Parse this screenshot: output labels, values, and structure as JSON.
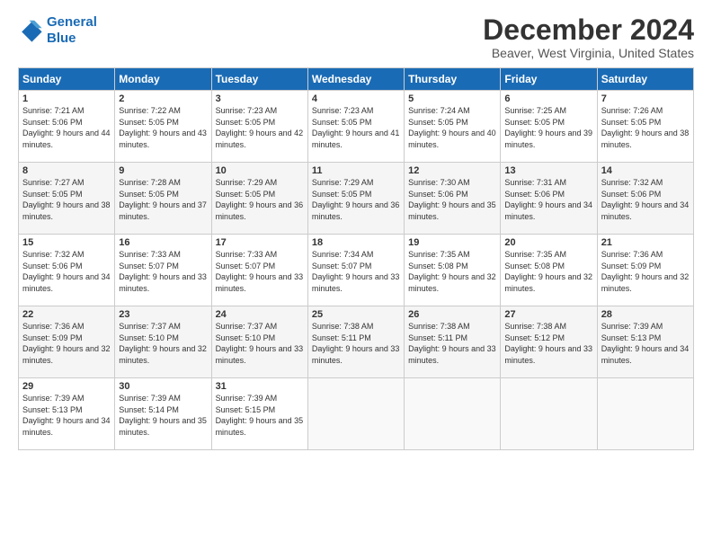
{
  "logo": {
    "line1": "General",
    "line2": "Blue"
  },
  "title": "December 2024",
  "subtitle": "Beaver, West Virginia, United States",
  "days_header": [
    "Sunday",
    "Monday",
    "Tuesday",
    "Wednesday",
    "Thursday",
    "Friday",
    "Saturday"
  ],
  "weeks": [
    [
      {
        "day": "1",
        "sunrise": "Sunrise: 7:21 AM",
        "sunset": "Sunset: 5:06 PM",
        "daylight": "Daylight: 9 hours and 44 minutes."
      },
      {
        "day": "2",
        "sunrise": "Sunrise: 7:22 AM",
        "sunset": "Sunset: 5:05 PM",
        "daylight": "Daylight: 9 hours and 43 minutes."
      },
      {
        "day": "3",
        "sunrise": "Sunrise: 7:23 AM",
        "sunset": "Sunset: 5:05 PM",
        "daylight": "Daylight: 9 hours and 42 minutes."
      },
      {
        "day": "4",
        "sunrise": "Sunrise: 7:23 AM",
        "sunset": "Sunset: 5:05 PM",
        "daylight": "Daylight: 9 hours and 41 minutes."
      },
      {
        "day": "5",
        "sunrise": "Sunrise: 7:24 AM",
        "sunset": "Sunset: 5:05 PM",
        "daylight": "Daylight: 9 hours and 40 minutes."
      },
      {
        "day": "6",
        "sunrise": "Sunrise: 7:25 AM",
        "sunset": "Sunset: 5:05 PM",
        "daylight": "Daylight: 9 hours and 39 minutes."
      },
      {
        "day": "7",
        "sunrise": "Sunrise: 7:26 AM",
        "sunset": "Sunset: 5:05 PM",
        "daylight": "Daylight: 9 hours and 38 minutes."
      }
    ],
    [
      {
        "day": "8",
        "sunrise": "Sunrise: 7:27 AM",
        "sunset": "Sunset: 5:05 PM",
        "daylight": "Daylight: 9 hours and 38 minutes."
      },
      {
        "day": "9",
        "sunrise": "Sunrise: 7:28 AM",
        "sunset": "Sunset: 5:05 PM",
        "daylight": "Daylight: 9 hours and 37 minutes."
      },
      {
        "day": "10",
        "sunrise": "Sunrise: 7:29 AM",
        "sunset": "Sunset: 5:05 PM",
        "daylight": "Daylight: 9 hours and 36 minutes."
      },
      {
        "day": "11",
        "sunrise": "Sunrise: 7:29 AM",
        "sunset": "Sunset: 5:05 PM",
        "daylight": "Daylight: 9 hours and 36 minutes."
      },
      {
        "day": "12",
        "sunrise": "Sunrise: 7:30 AM",
        "sunset": "Sunset: 5:06 PM",
        "daylight": "Daylight: 9 hours and 35 minutes."
      },
      {
        "day": "13",
        "sunrise": "Sunrise: 7:31 AM",
        "sunset": "Sunset: 5:06 PM",
        "daylight": "Daylight: 9 hours and 34 minutes."
      },
      {
        "day": "14",
        "sunrise": "Sunrise: 7:32 AM",
        "sunset": "Sunset: 5:06 PM",
        "daylight": "Daylight: 9 hours and 34 minutes."
      }
    ],
    [
      {
        "day": "15",
        "sunrise": "Sunrise: 7:32 AM",
        "sunset": "Sunset: 5:06 PM",
        "daylight": "Daylight: 9 hours and 34 minutes."
      },
      {
        "day": "16",
        "sunrise": "Sunrise: 7:33 AM",
        "sunset": "Sunset: 5:07 PM",
        "daylight": "Daylight: 9 hours and 33 minutes."
      },
      {
        "day": "17",
        "sunrise": "Sunrise: 7:33 AM",
        "sunset": "Sunset: 5:07 PM",
        "daylight": "Daylight: 9 hours and 33 minutes."
      },
      {
        "day": "18",
        "sunrise": "Sunrise: 7:34 AM",
        "sunset": "Sunset: 5:07 PM",
        "daylight": "Daylight: 9 hours and 33 minutes."
      },
      {
        "day": "19",
        "sunrise": "Sunrise: 7:35 AM",
        "sunset": "Sunset: 5:08 PM",
        "daylight": "Daylight: 9 hours and 32 minutes."
      },
      {
        "day": "20",
        "sunrise": "Sunrise: 7:35 AM",
        "sunset": "Sunset: 5:08 PM",
        "daylight": "Daylight: 9 hours and 32 minutes."
      },
      {
        "day": "21",
        "sunrise": "Sunrise: 7:36 AM",
        "sunset": "Sunset: 5:09 PM",
        "daylight": "Daylight: 9 hours and 32 minutes."
      }
    ],
    [
      {
        "day": "22",
        "sunrise": "Sunrise: 7:36 AM",
        "sunset": "Sunset: 5:09 PM",
        "daylight": "Daylight: 9 hours and 32 minutes."
      },
      {
        "day": "23",
        "sunrise": "Sunrise: 7:37 AM",
        "sunset": "Sunset: 5:10 PM",
        "daylight": "Daylight: 9 hours and 32 minutes."
      },
      {
        "day": "24",
        "sunrise": "Sunrise: 7:37 AM",
        "sunset": "Sunset: 5:10 PM",
        "daylight": "Daylight: 9 hours and 33 minutes."
      },
      {
        "day": "25",
        "sunrise": "Sunrise: 7:38 AM",
        "sunset": "Sunset: 5:11 PM",
        "daylight": "Daylight: 9 hours and 33 minutes."
      },
      {
        "day": "26",
        "sunrise": "Sunrise: 7:38 AM",
        "sunset": "Sunset: 5:11 PM",
        "daylight": "Daylight: 9 hours and 33 minutes."
      },
      {
        "day": "27",
        "sunrise": "Sunrise: 7:38 AM",
        "sunset": "Sunset: 5:12 PM",
        "daylight": "Daylight: 9 hours and 33 minutes."
      },
      {
        "day": "28",
        "sunrise": "Sunrise: 7:39 AM",
        "sunset": "Sunset: 5:13 PM",
        "daylight": "Daylight: 9 hours and 34 minutes."
      }
    ],
    [
      {
        "day": "29",
        "sunrise": "Sunrise: 7:39 AM",
        "sunset": "Sunset: 5:13 PM",
        "daylight": "Daylight: 9 hours and 34 minutes."
      },
      {
        "day": "30",
        "sunrise": "Sunrise: 7:39 AM",
        "sunset": "Sunset: 5:14 PM",
        "daylight": "Daylight: 9 hours and 35 minutes."
      },
      {
        "day": "31",
        "sunrise": "Sunrise: 7:39 AM",
        "sunset": "Sunset: 5:15 PM",
        "daylight": "Daylight: 9 hours and 35 minutes."
      },
      null,
      null,
      null,
      null
    ]
  ]
}
